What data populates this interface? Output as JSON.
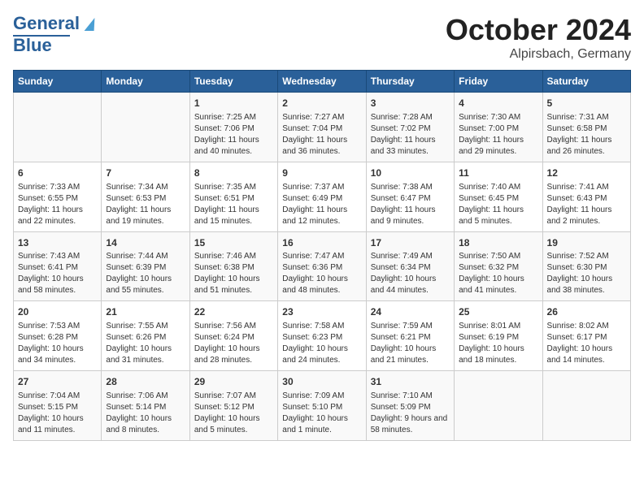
{
  "header": {
    "logo_line1": "General",
    "logo_line2": "Blue",
    "title": "October 2024",
    "subtitle": "Alpirsbach, Germany"
  },
  "days_of_week": [
    "Sunday",
    "Monday",
    "Tuesday",
    "Wednesday",
    "Thursday",
    "Friday",
    "Saturday"
  ],
  "weeks": [
    [
      {
        "day": "",
        "detail": ""
      },
      {
        "day": "",
        "detail": ""
      },
      {
        "day": "1",
        "detail": "Sunrise: 7:25 AM\nSunset: 7:06 PM\nDaylight: 11 hours and 40 minutes."
      },
      {
        "day": "2",
        "detail": "Sunrise: 7:27 AM\nSunset: 7:04 PM\nDaylight: 11 hours and 36 minutes."
      },
      {
        "day": "3",
        "detail": "Sunrise: 7:28 AM\nSunset: 7:02 PM\nDaylight: 11 hours and 33 minutes."
      },
      {
        "day": "4",
        "detail": "Sunrise: 7:30 AM\nSunset: 7:00 PM\nDaylight: 11 hours and 29 minutes."
      },
      {
        "day": "5",
        "detail": "Sunrise: 7:31 AM\nSunset: 6:58 PM\nDaylight: 11 hours and 26 minutes."
      }
    ],
    [
      {
        "day": "6",
        "detail": "Sunrise: 7:33 AM\nSunset: 6:55 PM\nDaylight: 11 hours and 22 minutes."
      },
      {
        "day": "7",
        "detail": "Sunrise: 7:34 AM\nSunset: 6:53 PM\nDaylight: 11 hours and 19 minutes."
      },
      {
        "day": "8",
        "detail": "Sunrise: 7:35 AM\nSunset: 6:51 PM\nDaylight: 11 hours and 15 minutes."
      },
      {
        "day": "9",
        "detail": "Sunrise: 7:37 AM\nSunset: 6:49 PM\nDaylight: 11 hours and 12 minutes."
      },
      {
        "day": "10",
        "detail": "Sunrise: 7:38 AM\nSunset: 6:47 PM\nDaylight: 11 hours and 9 minutes."
      },
      {
        "day": "11",
        "detail": "Sunrise: 7:40 AM\nSunset: 6:45 PM\nDaylight: 11 hours and 5 minutes."
      },
      {
        "day": "12",
        "detail": "Sunrise: 7:41 AM\nSunset: 6:43 PM\nDaylight: 11 hours and 2 minutes."
      }
    ],
    [
      {
        "day": "13",
        "detail": "Sunrise: 7:43 AM\nSunset: 6:41 PM\nDaylight: 10 hours and 58 minutes."
      },
      {
        "day": "14",
        "detail": "Sunrise: 7:44 AM\nSunset: 6:39 PM\nDaylight: 10 hours and 55 minutes."
      },
      {
        "day": "15",
        "detail": "Sunrise: 7:46 AM\nSunset: 6:38 PM\nDaylight: 10 hours and 51 minutes."
      },
      {
        "day": "16",
        "detail": "Sunrise: 7:47 AM\nSunset: 6:36 PM\nDaylight: 10 hours and 48 minutes."
      },
      {
        "day": "17",
        "detail": "Sunrise: 7:49 AM\nSunset: 6:34 PM\nDaylight: 10 hours and 44 minutes."
      },
      {
        "day": "18",
        "detail": "Sunrise: 7:50 AM\nSunset: 6:32 PM\nDaylight: 10 hours and 41 minutes."
      },
      {
        "day": "19",
        "detail": "Sunrise: 7:52 AM\nSunset: 6:30 PM\nDaylight: 10 hours and 38 minutes."
      }
    ],
    [
      {
        "day": "20",
        "detail": "Sunrise: 7:53 AM\nSunset: 6:28 PM\nDaylight: 10 hours and 34 minutes."
      },
      {
        "day": "21",
        "detail": "Sunrise: 7:55 AM\nSunset: 6:26 PM\nDaylight: 10 hours and 31 minutes."
      },
      {
        "day": "22",
        "detail": "Sunrise: 7:56 AM\nSunset: 6:24 PM\nDaylight: 10 hours and 28 minutes."
      },
      {
        "day": "23",
        "detail": "Sunrise: 7:58 AM\nSunset: 6:23 PM\nDaylight: 10 hours and 24 minutes."
      },
      {
        "day": "24",
        "detail": "Sunrise: 7:59 AM\nSunset: 6:21 PM\nDaylight: 10 hours and 21 minutes."
      },
      {
        "day": "25",
        "detail": "Sunrise: 8:01 AM\nSunset: 6:19 PM\nDaylight: 10 hours and 18 minutes."
      },
      {
        "day": "26",
        "detail": "Sunrise: 8:02 AM\nSunset: 6:17 PM\nDaylight: 10 hours and 14 minutes."
      }
    ],
    [
      {
        "day": "27",
        "detail": "Sunrise: 7:04 AM\nSunset: 5:15 PM\nDaylight: 10 hours and 11 minutes."
      },
      {
        "day": "28",
        "detail": "Sunrise: 7:06 AM\nSunset: 5:14 PM\nDaylight: 10 hours and 8 minutes."
      },
      {
        "day": "29",
        "detail": "Sunrise: 7:07 AM\nSunset: 5:12 PM\nDaylight: 10 hours and 5 minutes."
      },
      {
        "day": "30",
        "detail": "Sunrise: 7:09 AM\nSunset: 5:10 PM\nDaylight: 10 hours and 1 minute."
      },
      {
        "day": "31",
        "detail": "Sunrise: 7:10 AM\nSunset: 5:09 PM\nDaylight: 9 hours and 58 minutes."
      },
      {
        "day": "",
        "detail": ""
      },
      {
        "day": "",
        "detail": ""
      }
    ]
  ]
}
